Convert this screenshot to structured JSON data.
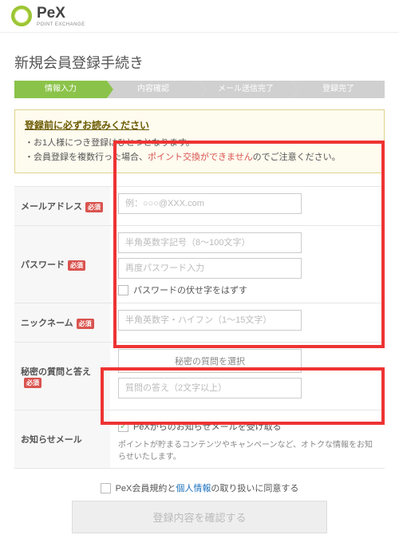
{
  "logo": {
    "text": "PeX",
    "sub": "POINT EXCHANGE"
  },
  "page_title": "新規会員登録手続き",
  "steps": [
    "情報入力",
    "内容確認",
    "メール送信完了",
    "登録完了"
  ],
  "notice": {
    "title": "登録前に必ずお読みください",
    "line1": "・お1人様につき登録はひとつとなります。",
    "line2a": "・会員登録を複数行った場合、",
    "line2hl": "ポイント交換ができません",
    "line2b": "のでご注意ください。"
  },
  "form": {
    "email": {
      "label": "メールアドレス",
      "req": "必須",
      "placeholder": "例：○○○@XXX.com"
    },
    "password": {
      "label": "パスワード",
      "req": "必須",
      "placeholder1": "半角英数字記号（8～100文字）",
      "placeholder2": "再度パスワード入力",
      "show_chk": "パスワードの伏せ字をはずす"
    },
    "nickname": {
      "label": "ニックネーム",
      "req": "必須",
      "placeholder": "半角英数字・ハイフン（1～15文字）"
    },
    "secret": {
      "label": "秘密の質問と答え",
      "req": "必須",
      "select_placeholder": "秘密の質問を選択",
      "answer_placeholder": "質問の答え（2文字以上）"
    },
    "newsletter": {
      "label": "お知らせメール",
      "chk_label": "PeXからのお知らせメールを受け取る",
      "note": "ポイントが貯まるコンテンツやキャンペーンなど、オトクな情報をお知らせいたします。"
    }
  },
  "agree": {
    "pre": "PeX会員規約と",
    "link": "個人情報",
    "post": "の取り扱いに同意する"
  },
  "submit": "登録内容を確認する"
}
